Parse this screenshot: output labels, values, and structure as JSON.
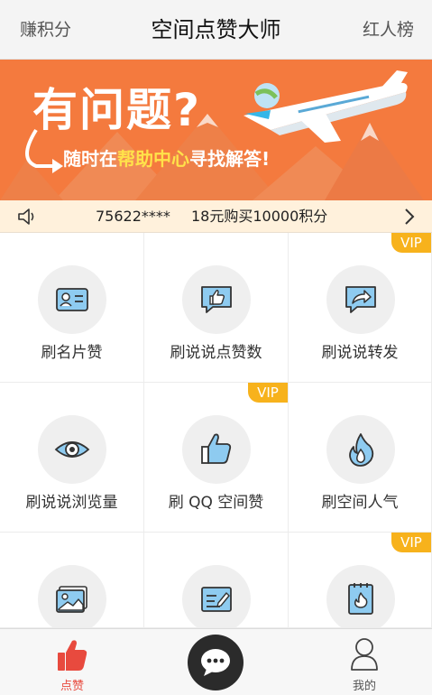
{
  "header": {
    "left_label": "赚积分",
    "title": "空间点赞大师",
    "right_label": "红人榜"
  },
  "banner": {
    "headline": "有问题?",
    "sub_before": "随时在",
    "sub_highlight": "帮助中心",
    "sub_after": "寻找解答!"
  },
  "notice": {
    "user": "75622****",
    "message": "18元购买10000积分"
  },
  "grid": {
    "vip_label": "VIP",
    "items": [
      {
        "label": "刷名片赞",
        "icon": "id-card-icon",
        "vip": false
      },
      {
        "label": "刷说说点赞数",
        "icon": "thumbs-up-bubble-icon",
        "vip": false
      },
      {
        "label": "刷说说转发",
        "icon": "share-bubble-icon",
        "vip": true
      },
      {
        "label": "刷说说浏览量",
        "icon": "eye-icon",
        "vip": false
      },
      {
        "label": "刷 QQ 空间赞",
        "icon": "thumbs-up-icon",
        "vip": true
      },
      {
        "label": "刷空间人气",
        "icon": "flame-icon",
        "vip": false
      },
      {
        "label": "",
        "icon": "photo-icon",
        "vip": false
      },
      {
        "label": "",
        "icon": "edit-note-icon",
        "vip": false
      },
      {
        "label": "",
        "icon": "fire-card-icon",
        "vip": true
      }
    ]
  },
  "bottom_nav": {
    "like_label": "点赞",
    "mine_label": "我的"
  },
  "colors": {
    "banner_orange": "#f47a3e",
    "highlight_yellow": "#ffe24a",
    "vip_badge": "#f7b21c",
    "icon_blue": "#8ecbf0",
    "active_red": "#e84a3e"
  }
}
